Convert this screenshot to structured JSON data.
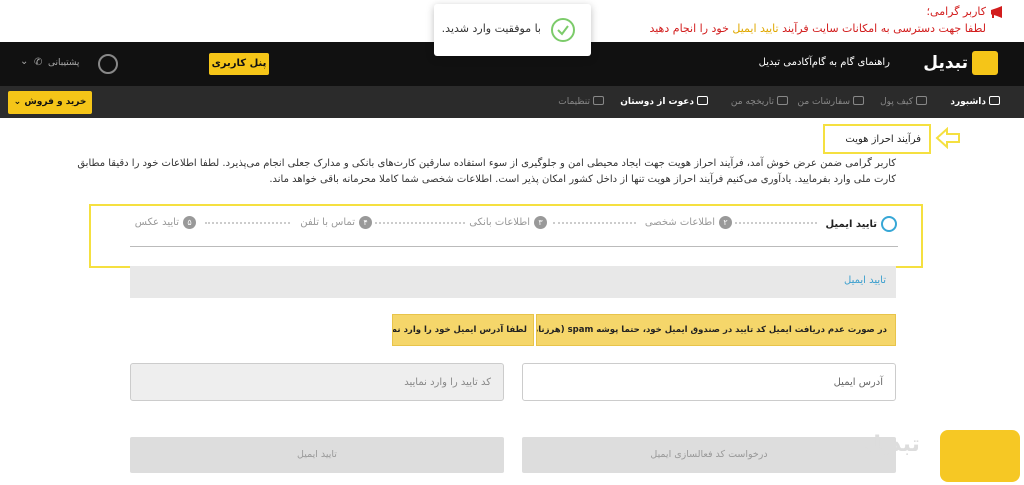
{
  "alert": {
    "line1": "کاربر گرامی؛",
    "line2_before": "لطفا جهت دسترسی به امکانات سایت فرآیند",
    "line2_highlight": "تایید ایمیل",
    "line2_after": "خود را انجام دهید"
  },
  "toast": {
    "message": "با موفقیت وارد شدید."
  },
  "header": {
    "logo_text": "تبدیل",
    "nav": [
      "راهنمای گام به گام",
      "آکادمی تبدیل"
    ],
    "panel_button": "پنل کاربری",
    "support": "پشتیبانی"
  },
  "subnav": {
    "items": [
      {
        "label": "داشبورد",
        "active": true
      },
      {
        "label": "کیف پول",
        "active": false
      },
      {
        "label": "سفارشات من",
        "active": false
      },
      {
        "label": "تاریخچه من",
        "active": false
      },
      {
        "label": "دعوت از دوستان",
        "active": true
      },
      {
        "label": "تنظیمات",
        "active": false
      }
    ],
    "buy_button": "خرید و فروش"
  },
  "page": {
    "title": "فرآیند احراز هویت",
    "intro_line1": "کاربر گرامی ضمن عرض خوش آمد، فرآیند احراز هویت جهت ایجاد محیطی امن و جلوگیری از سوء استفاده سارقین کارت‌های بانکی و مدارک جعلی انجام می‌پذیرد. لطفا اطلاعات خود را دقیقا مطابق",
    "intro_line2": "کارت ملی وارد بفرمایید. یادآوری می‌کنیم فرآیند احراز هویت تنها از داخل کشور امکان پذیر است. اطلاعات شخصی شما کاملا محرمانه باقی خواهد ماند."
  },
  "steps": [
    {
      "num": "",
      "label": "تایید ایمیل",
      "active": true
    },
    {
      "num": "۲",
      "label": "اطلاعات شخصی",
      "active": false
    },
    {
      "num": "۳",
      "label": "اطلاعات بانکی",
      "active": false
    },
    {
      "num": "۴",
      "label": "تماس با تلفن",
      "active": false
    },
    {
      "num": "۵",
      "label": "تایید عکس",
      "active": false
    }
  ],
  "card": {
    "heading": "تایید ایمیل",
    "warning1": "در صورت عدم دریافت ایمیل کد تایید در صندوق ایمیل خود، حتما پوشه spam (هرزنامه) را بررسی کنید.",
    "warning2": "لطفا آدرس ایمیل خود را وارد نمایید؛",
    "email_placeholder": "آدرس ایمیل",
    "code_placeholder": "کد تایید را وارد نمایید",
    "request_button": "درخواست کد فعالسازی ایمیل",
    "verify_button": "تایید ایمیل"
  },
  "watermark": "تبدیل",
  "colors": {
    "accent": "#f5c518",
    "alert": "#d21d1d",
    "link": "#3b9fce",
    "dark": "#111111"
  }
}
